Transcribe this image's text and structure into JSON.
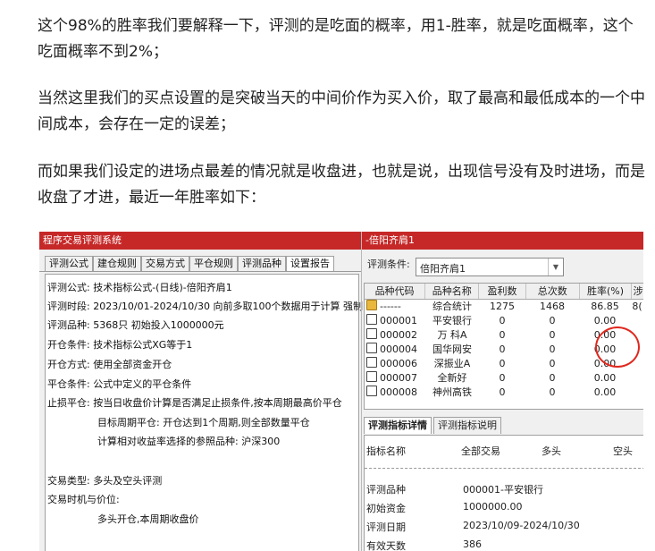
{
  "article": {
    "p1": "这个98%的胜率我们要解释一下，评测的是吃面的概率，用1-胜率，就是吃面概率，这个吃面概率不到2%；",
    "p2": "当然这里我们的买点设置的是突破当天的中间价作为买入价，取了最高和最低成本的一个中间成本，会存在一定的误差；",
    "p3": "而如果我们设定的进场点最差的情况就是收盘进，也就是说，出现信号没有及时进场，而是收盘了才进，最近一年胜率如下："
  },
  "left_window": {
    "title": "程序交易评测系统",
    "tabs": [
      "评测公式",
      "建仓规则",
      "交易方式",
      "平仓规则",
      "评测品种",
      "设置报告"
    ],
    "active_tab": 5,
    "report_lines": [
      "评测公式: 技术指标公式-(日线)-倍阳齐肩1",
      "评测时段: 2023/10/01-2024/10/30 向前多取100个数据用于计算 强制",
      "评测品种: 5368只 初始投入1000000元",
      "开仓条件: 技术指标公式XG等于1",
      "开仓方式: 使用全部资金开仓",
      "平仓条件: 公式中定义的平仓条件",
      "止损平仓: 按当日收盘价计算是否满足止损条件,按本周期最高价平仓",
      "目标周期平仓: 开仓达到1个周期,则全部数量平仓",
      "计算相对收益率选择的参照品种: 沪深300",
      "交易类型: 多头及空头评测",
      "交易时机与价位:",
      "多头开仓,本周期收盘价"
    ]
  },
  "right_window": {
    "title": "-倍阳齐肩1",
    "condition_label": "评测条件:",
    "condition_value": "倍阳齐肩1",
    "columns": [
      "品种代码",
      "品种名称",
      "盈利数",
      "总次数",
      "胜率(%)",
      "涉"
    ],
    "rows": [
      {
        "code": "------",
        "name": "综合统计",
        "win": "1275",
        "total": "1468",
        "rate": "86.85",
        "extra": "8("
      },
      {
        "code": "000001",
        "name": "平安银行",
        "win": "0",
        "total": "0",
        "rate": "0.00",
        "extra": ""
      },
      {
        "code": "000002",
        "name": "万 科A",
        "win": "0",
        "total": "0",
        "rate": "0.00",
        "extra": ""
      },
      {
        "code": "000004",
        "name": "国华网安",
        "win": "0",
        "total": "0",
        "rate": "0.00",
        "extra": ""
      },
      {
        "code": "000006",
        "name": "深振业A",
        "win": "0",
        "total": "0",
        "rate": "0.00",
        "extra": ""
      },
      {
        "code": "000007",
        "name": "全新好",
        "win": "0",
        "total": "0",
        "rate": "0.00",
        "extra": ""
      },
      {
        "code": "000008",
        "name": "神州高铁",
        "win": "0",
        "total": "0",
        "rate": "0.00",
        "extra": ""
      }
    ],
    "bottom_tabs": [
      "评测指标详情",
      "评测指标说明"
    ],
    "detail_headers": [
      "指标名称",
      "全部交易",
      "多头",
      "空头"
    ],
    "details": [
      {
        "label": "评测品种",
        "value": "000001-平安银行"
      },
      {
        "label": "初始资金",
        "value": "1000000.00"
      },
      {
        "label": "评测日期",
        "value": "2023/10/09-2024/10/30"
      },
      {
        "label": "有效天数",
        "value": "386"
      }
    ],
    "colors": {
      "titlebar": "#c62828",
      "highlight_circle": "#e0281e",
      "folder_icon": "#e8b73c"
    }
  }
}
